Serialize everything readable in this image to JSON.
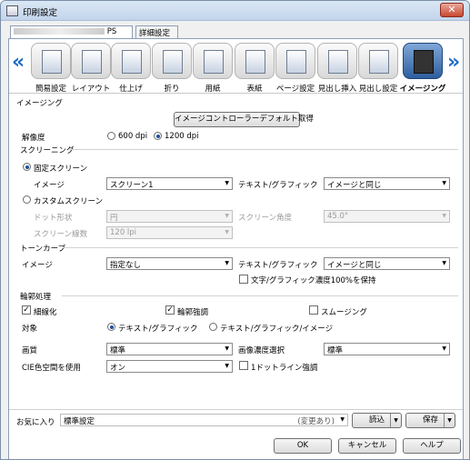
{
  "window": {
    "title": "印刷設定",
    "close": "✕"
  },
  "tabs": {
    "printer_suffix": "PS",
    "detail": "詳細設定"
  },
  "nav": {
    "prev": "«",
    "next": "»"
  },
  "categories": [
    {
      "label": "簡易設定",
      "icon": "quick-settings-icon"
    },
    {
      "label": "レイアウト",
      "icon": "layout-icon"
    },
    {
      "label": "仕上げ",
      "icon": "finishing-icon"
    },
    {
      "label": "折り",
      "icon": "fold-icon"
    },
    {
      "label": "用紙",
      "icon": "paper-icon"
    },
    {
      "label": "表紙",
      "icon": "cover-icon"
    },
    {
      "label": "ページ設定",
      "icon": "page-setup-icon"
    },
    {
      "label": "見出し挿入",
      "icon": "tab-insert-icon"
    },
    {
      "label": "見出し設定",
      "icon": "tab-settings-icon"
    },
    {
      "label": "イメージング",
      "icon": "imaging-icon"
    }
  ],
  "imaging": {
    "header": "イメージング",
    "controller_default_btn": "イメージコントローラーデフォルト取得",
    "resolution": {
      "label": "解像度",
      "opt1": "600 dpi",
      "opt2": "1200 dpi",
      "selected": "1200 dpi"
    },
    "screening": {
      "header": "スクリーニング",
      "fixed_label": "固定スクリーン",
      "image_label": "イメージ",
      "image_value": "スクリーン1",
      "text_graphic_label": "テキスト/グラフィック",
      "text_graphic_value": "イメージと同じ",
      "custom_label": "カスタムスクリーン",
      "dot_shape_label": "ドット形状",
      "dot_shape_value": "円",
      "angle_label": "スクリーン角度",
      "angle_value": "45.0°",
      "lines_label": "スクリーン線数",
      "lines_value": "120 lpi"
    },
    "tone_curve": {
      "header": "トーンカーブ",
      "image_label": "イメージ",
      "image_value": "指定なし",
      "text_graphic_label": "テキスト/グラフィック",
      "text_graphic_value": "イメージと同じ",
      "keep_density_label": "文字/グラフィック濃度100%を保持"
    },
    "edge": {
      "header": "輪郭処理",
      "thin_label": "細線化",
      "edge_label": "輪郭強調",
      "smoothing_label": "スムージング",
      "target_label": "対象",
      "target_opt1": "テキスト/グラフィック",
      "target_opt2": "テキスト/グラフィック/イメージ"
    },
    "quality": {
      "label": "画質",
      "value": "標準"
    },
    "density": {
      "label": "画像濃度選択",
      "value": "標準"
    },
    "cie": {
      "label": "CIE色空間を使用",
      "value": "オン"
    },
    "one_dot_line_label": "1ドットライン強調"
  },
  "favorites": {
    "label": "お気に入り",
    "value": "標準設定",
    "changed": "(変更あり)",
    "load": "読込",
    "save": "保存"
  },
  "buttons": {
    "ok": "OK",
    "cancel": "キャンセル",
    "help": "ヘルプ"
  }
}
